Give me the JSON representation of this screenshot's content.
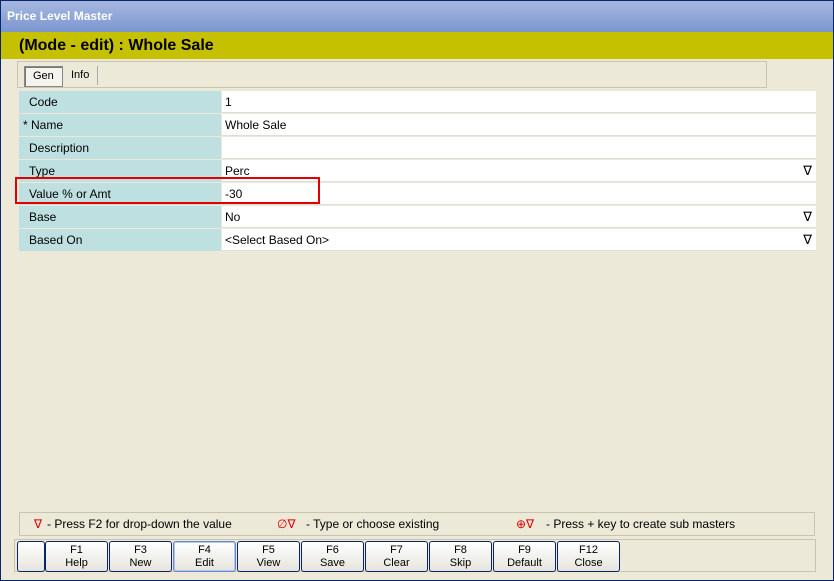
{
  "window": {
    "title": "Price Level Master"
  },
  "mode_bar": {
    "text": "(Mode - edit)  :  Whole Sale"
  },
  "tabs": [
    {
      "label": "Gen",
      "active": true
    },
    {
      "label": "Info",
      "active": false
    }
  ],
  "fields": [
    {
      "label": "Code",
      "value": "1",
      "dropdown": false
    },
    {
      "label": "* Name",
      "value": "Whole Sale",
      "dropdown": false
    },
    {
      "label": "Description",
      "value": "",
      "dropdown": false
    },
    {
      "label": "Type",
      "value": "Perc",
      "dropdown": true
    },
    {
      "label": "Value % or Amt",
      "value": "-30",
      "dropdown": false,
      "highlighted": true
    },
    {
      "label": "Base",
      "value": "No",
      "dropdown": true
    },
    {
      "label": "Based On",
      "value": "<Select Based On>",
      "dropdown": true
    }
  ],
  "legend": {
    "dropdown_symbol": "∇",
    "dropdown_text": "- Press F2 for drop-down the value",
    "existing_symbol": "∅∇",
    "existing_text": "- Type or choose existing",
    "sub_symbol": "⊕∇",
    "sub_text": "- Press + key to create sub masters"
  },
  "buttons": [
    {
      "key": "F1",
      "label": "Help"
    },
    {
      "key": "F3",
      "label": "New"
    },
    {
      "key": "F4",
      "label": "Edit",
      "focused": true
    },
    {
      "key": "F5",
      "label": "View"
    },
    {
      "key": "F6",
      "label": "Save"
    },
    {
      "key": "F7",
      "label": "Clear"
    },
    {
      "key": "F8",
      "label": "Skip"
    },
    {
      "key": "F9",
      "label": "Default"
    },
    {
      "key": "F12",
      "label": "Close"
    }
  ],
  "colors": {
    "mode_bar": "#c5c000",
    "label_bg": "#bfe0e0",
    "highlight": "#e00000"
  }
}
